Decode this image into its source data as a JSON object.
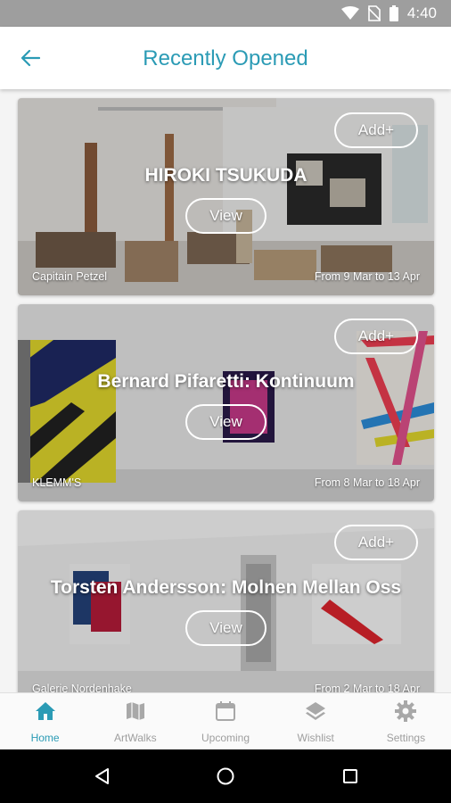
{
  "status_bar": {
    "time": "4:40",
    "icons": [
      "wifi-icon",
      "no-sim-icon",
      "battery-icon"
    ]
  },
  "header": {
    "title": "Recently Opened",
    "back_icon": "arrow-left-icon"
  },
  "colors": {
    "accent": "#2b9bb5",
    "inactive": "#9e9e9e"
  },
  "exhibitions": [
    {
      "title": "HIROKI TSUKUDA",
      "gallery": "Capitain Petzel",
      "dates": "From 9 Mar to 13 Apr",
      "add_label": "Add+",
      "view_label": "View"
    },
    {
      "title": "Bernard Pifaretti: Kontinuum",
      "gallery": "KLEMM'S",
      "dates": "From 8 Mar to 18 Apr",
      "add_label": "Add+",
      "view_label": "View"
    },
    {
      "title": "Torsten Andersson: Molnen Mellan Oss",
      "gallery": "Galerie Nordenhake",
      "dates": "From 2 Mar to 18 Apr",
      "add_label": "Add+",
      "view_label": "View"
    }
  ],
  "bottom_nav": [
    {
      "label": "Home",
      "icon": "home-icon",
      "active": true
    },
    {
      "label": "ArtWalks",
      "icon": "map-icon",
      "active": false
    },
    {
      "label": "Upcoming",
      "icon": "calendar-icon",
      "active": false
    },
    {
      "label": "Wishlist",
      "icon": "layers-icon",
      "active": false
    },
    {
      "label": "Settings",
      "icon": "gear-icon",
      "active": false
    }
  ],
  "system_nav": [
    "back-triangle-icon",
    "home-circle-icon",
    "recents-square-icon"
  ]
}
